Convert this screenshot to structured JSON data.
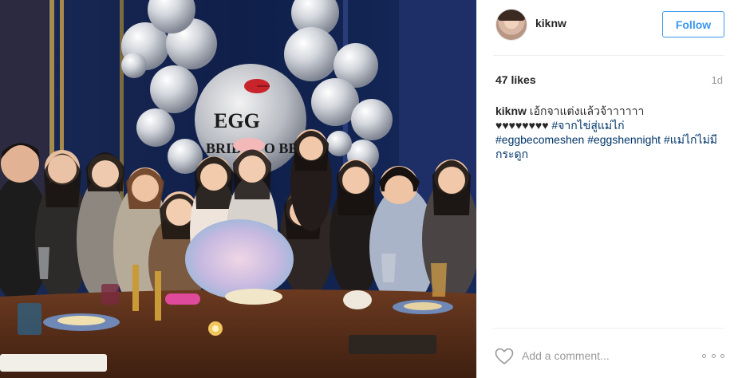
{
  "post": {
    "username": "kiknw",
    "follow_label": "Follow",
    "likes": "47 likes",
    "age": "1d",
    "photo_text": {
      "balloon_line1": "EGG",
      "balloon_line2": "BRIDE TO BE"
    },
    "caption": {
      "user": "kiknw",
      "text": "เอ้กจาแต่งแล้วจ้าาาาาา",
      "hearts": "♥♥♥♥♥♥♥♥",
      "tags": [
        "#จากไข่สู่แม่ไก่",
        "#eggbecomeshen",
        "#eggshennight",
        "#แม่ไก่ไม่มีกระดูก"
      ]
    },
    "comment": {
      "placeholder": "Add a comment..."
    }
  },
  "colors": {
    "accent": "#3897f0",
    "hashtag": "#003569",
    "muted": "#999999",
    "divider": "#efefef"
  },
  "icons": {
    "like": "heart-outline-icon",
    "more": "more-options-icon"
  }
}
